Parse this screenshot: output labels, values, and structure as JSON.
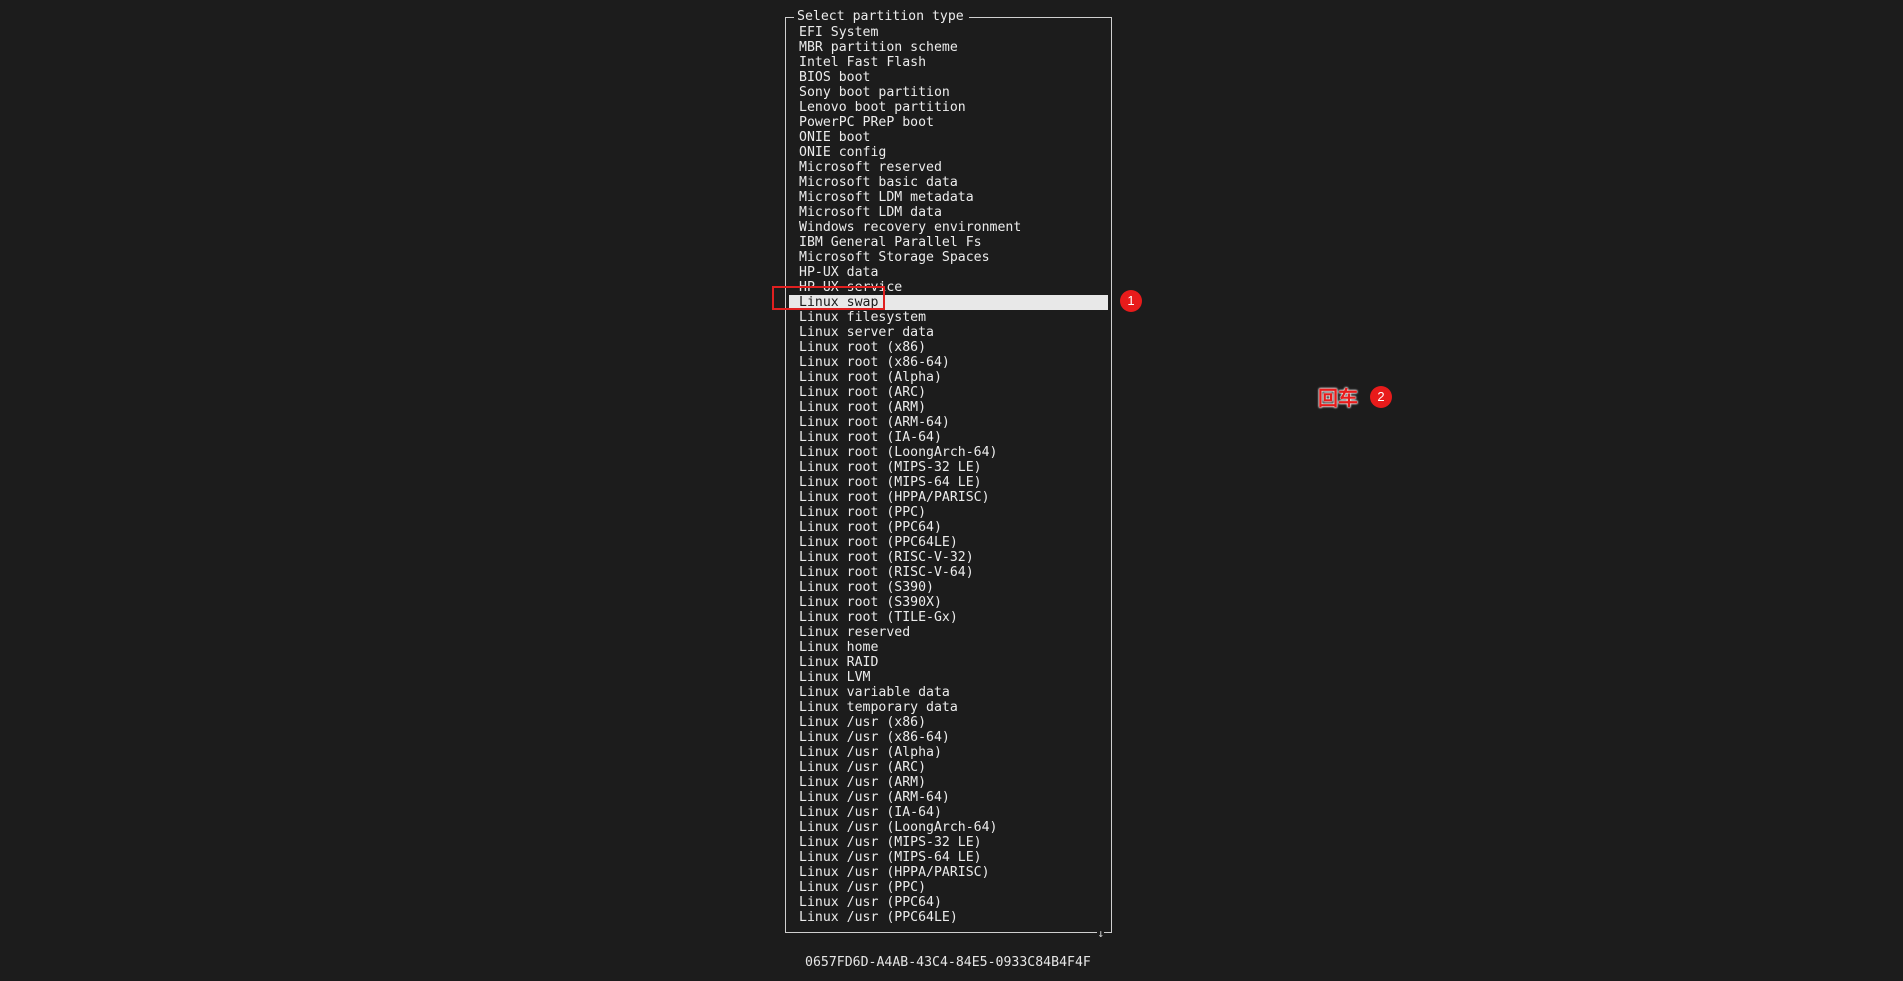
{
  "dialog": {
    "title": "Select partition type",
    "scroll_indicator": "↓",
    "selected_index": 18,
    "items": [
      "EFI System",
      "MBR partition scheme",
      "Intel Fast Flash",
      "BIOS boot",
      "Sony boot partition",
      "Lenovo boot partition",
      "PowerPC PReP boot",
      "ONIE boot",
      "ONIE config",
      "Microsoft reserved",
      "Microsoft basic data",
      "Microsoft LDM metadata",
      "Microsoft LDM data",
      "Windows recovery environment",
      "IBM General Parallel Fs",
      "Microsoft Storage Spaces",
      "HP-UX data",
      "HP-UX service",
      "Linux swap",
      "Linux filesystem",
      "Linux server data",
      "Linux root (x86)",
      "Linux root (x86-64)",
      "Linux root (Alpha)",
      "Linux root (ARC)",
      "Linux root (ARM)",
      "Linux root (ARM-64)",
      "Linux root (IA-64)",
      "Linux root (LoongArch-64)",
      "Linux root (MIPS-32 LE)",
      "Linux root (MIPS-64 LE)",
      "Linux root (HPPA/PARISC)",
      "Linux root (PPC)",
      "Linux root (PPC64)",
      "Linux root (PPC64LE)",
      "Linux root (RISC-V-32)",
      "Linux root (RISC-V-64)",
      "Linux root (S390)",
      "Linux root (S390X)",
      "Linux root (TILE-Gx)",
      "Linux reserved",
      "Linux home",
      "Linux RAID",
      "Linux LVM",
      "Linux variable data",
      "Linux temporary data",
      "Linux /usr (x86)",
      "Linux /usr (x86-64)",
      "Linux /usr (Alpha)",
      "Linux /usr (ARC)",
      "Linux /usr (ARM)",
      "Linux /usr (ARM-64)",
      "Linux /usr (IA-64)",
      "Linux /usr (LoongArch-64)",
      "Linux /usr (MIPS-32 LE)",
      "Linux /usr (MIPS-64 LE)",
      "Linux /usr (HPPA/PARISC)",
      "Linux /usr (PPC)",
      "Linux /usr (PPC64)",
      "Linux /usr (PPC64LE)"
    ]
  },
  "guid": "0657FD6D-A4AB-43C4-84E5-0933C84B4F4F",
  "annotations": {
    "step1_badge": "1",
    "step2_badge": "2",
    "step2_text": "回车",
    "color": "#e81b1b"
  }
}
